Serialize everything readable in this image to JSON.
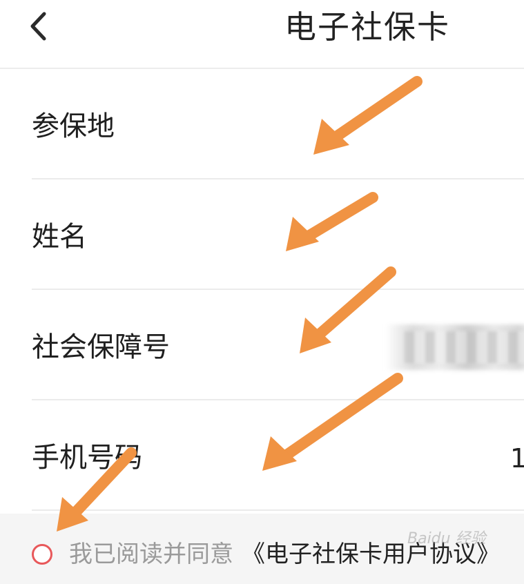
{
  "header": {
    "title": "电子社保卡"
  },
  "form": {
    "fields": [
      {
        "label": "参保地",
        "value": ""
      },
      {
        "label": "姓名",
        "value": ""
      },
      {
        "label": "社会保障号",
        "value": ""
      },
      {
        "label": "手机号码",
        "value": "1"
      }
    ]
  },
  "agreement": {
    "prefix": "我已阅读并同意",
    "link": "《电子社保卡用户协议》",
    "checked": false,
    "radio_color": "#e8585a"
  },
  "annotations": {
    "arrow_color": "#f09343"
  },
  "watermark": {
    "text": "Baidu 经验"
  }
}
